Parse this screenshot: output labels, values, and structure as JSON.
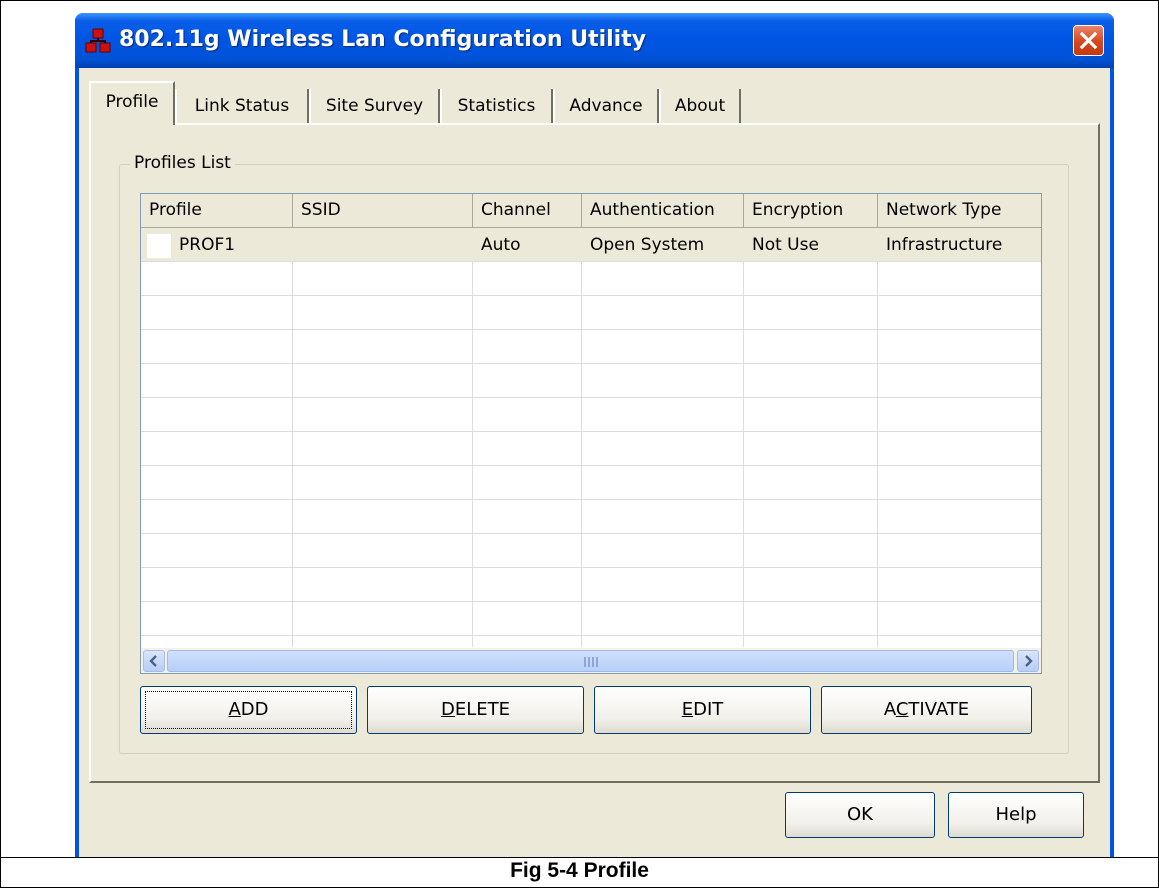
{
  "window": {
    "title": "802.11g Wireless Lan Configuration Utility"
  },
  "tabs": [
    {
      "label": "Profile",
      "active": true
    },
    {
      "label": "Link Status"
    },
    {
      "label": "Site Survey"
    },
    {
      "label": "Statistics"
    },
    {
      "label": "Advance"
    },
    {
      "label": "About"
    }
  ],
  "profiles_list": {
    "label": "Profiles List",
    "columns": [
      "Profile",
      "SSID",
      "Channel",
      "Authentication",
      "Encryption",
      "Network Type"
    ],
    "rows": [
      {
        "profile": "PROF1",
        "ssid": "",
        "channel": "Auto",
        "authentication": "Open System",
        "encryption": "Not Use",
        "network_type": "Infrastructure"
      }
    ]
  },
  "buttons": {
    "add": {
      "pre": "",
      "mnemonic": "A",
      "post": "DD"
    },
    "delete": {
      "pre": "",
      "mnemonic": "D",
      "post": "ELETE"
    },
    "edit": {
      "pre": "",
      "mnemonic": "E",
      "post": "DIT"
    },
    "activate": {
      "pre": "A",
      "mnemonic": "C",
      "post": "TIVATE"
    },
    "ok": "OK",
    "help": "Help"
  },
  "caption": "Fig 5-4 Profile"
}
